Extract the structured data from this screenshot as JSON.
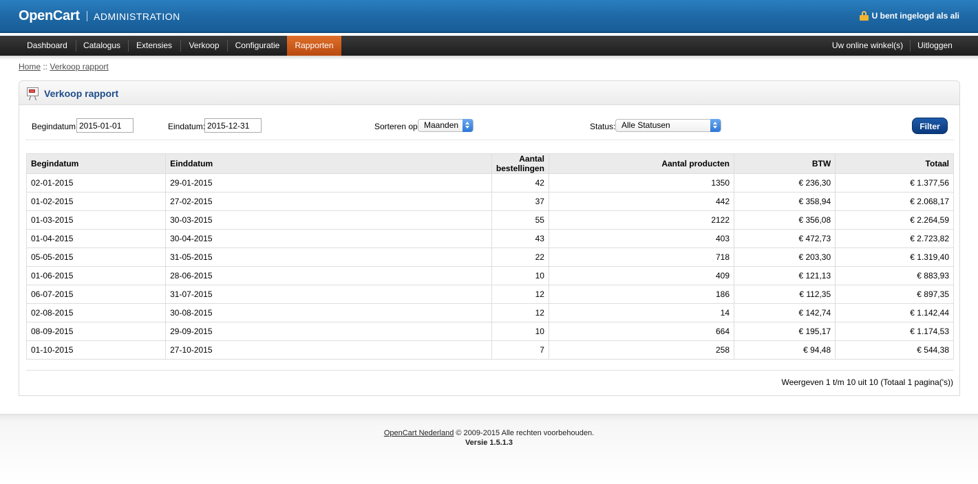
{
  "header": {
    "logo": "OpenCart",
    "subtitle": "ADMINISTRATION",
    "logged_in": "U bent ingelogd als ali"
  },
  "menu": {
    "dashboard": "Dashboard",
    "catalogus": "Catalogus",
    "extensies": "Extensies",
    "verkoop": "Verkoop",
    "configuratie": "Configuratie",
    "rapporten": "Rapporten",
    "online_store": "Uw online winkel(s)",
    "logout": "Uitloggen"
  },
  "breadcrumb": {
    "home": "Home",
    "separator": " :: ",
    "current": "Verkoop rapport"
  },
  "box": {
    "title": "Verkoop rapport"
  },
  "filter": {
    "date_start_label": "Begindatum:",
    "date_start_value": "2015-01-01",
    "date_end_label": "Eindatum:",
    "date_end_value": "2015-12-31",
    "group_label": "Sorteren op:",
    "group_value": "Maanden",
    "status_label": "Status:",
    "status_value": "Alle Statusen",
    "button": "Filter"
  },
  "table": {
    "headers": [
      "Begindatum",
      "Einddatum",
      "Aantal bestellingen",
      "Aantal producten",
      "BTW",
      "Totaal"
    ],
    "rows": [
      [
        "02-01-2015",
        "29-01-2015",
        "42",
        "1350",
        "€ 236,30",
        "€ 1.377,56"
      ],
      [
        "01-02-2015",
        "27-02-2015",
        "37",
        "442",
        "€ 358,94",
        "€ 2.068,17"
      ],
      [
        "01-03-2015",
        "30-03-2015",
        "55",
        "2122",
        "€ 356,08",
        "€ 2.264,59"
      ],
      [
        "01-04-2015",
        "30-04-2015",
        "43",
        "403",
        "€ 472,73",
        "€ 2.723,82"
      ],
      [
        "05-05-2015",
        "31-05-2015",
        "22",
        "718",
        "€ 203,30",
        "€ 1.319,40"
      ],
      [
        "01-06-2015",
        "28-06-2015",
        "10",
        "409",
        "€ 121,13",
        "€ 883,93"
      ],
      [
        "06-07-2015",
        "31-07-2015",
        "12",
        "186",
        "€ 112,35",
        "€ 897,35"
      ],
      [
        "02-08-2015",
        "30-08-2015",
        "12",
        "14",
        "€ 142,74",
        "€ 1.142,44"
      ],
      [
        "08-09-2015",
        "29-09-2015",
        "10",
        "664",
        "€ 195,17",
        "€ 1.174,53"
      ],
      [
        "01-10-2015",
        "27-10-2015",
        "7",
        "258",
        "€ 94,48",
        "€ 544,38"
      ]
    ]
  },
  "pagination": "Weergeven 1 t/m 10 uit 10 (Totaal 1 pagina('s))",
  "footer": {
    "link": "OpenCart Nederland",
    "copyright": " © 2009-2015 Alle rechten voorbehouden.",
    "version": "Versie 1.5.1.3"
  }
}
